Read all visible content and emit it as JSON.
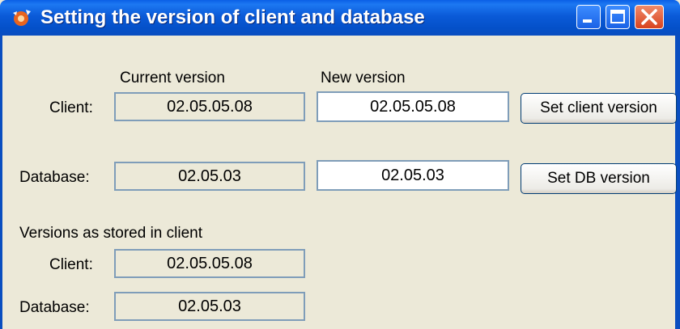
{
  "window": {
    "title": "Setting the version of client and database"
  },
  "titlebar": {
    "icon": "app-gear-icon",
    "minimize_icon": "minimize-icon",
    "maximize_icon": "maximize-icon",
    "close_icon": "close-icon"
  },
  "columns": {
    "current": "Current version",
    "new": "New version"
  },
  "client": {
    "label": "Client:",
    "current": "02.05.05.08",
    "new": "02.05.05.08",
    "button": "Set client version"
  },
  "database": {
    "label": "Database:",
    "current": "02.05.03",
    "new": "02.05.03",
    "button": "Set DB version"
  },
  "stored": {
    "heading": "Versions as stored in client",
    "client_label": "Client:",
    "client_value": "02.05.05.08",
    "database_label": "Database:",
    "database_value": "02.05.03"
  },
  "colors": {
    "titlebar": "#0a5ad8",
    "face": "#ece9d8",
    "field_border": "#7f9db9"
  }
}
